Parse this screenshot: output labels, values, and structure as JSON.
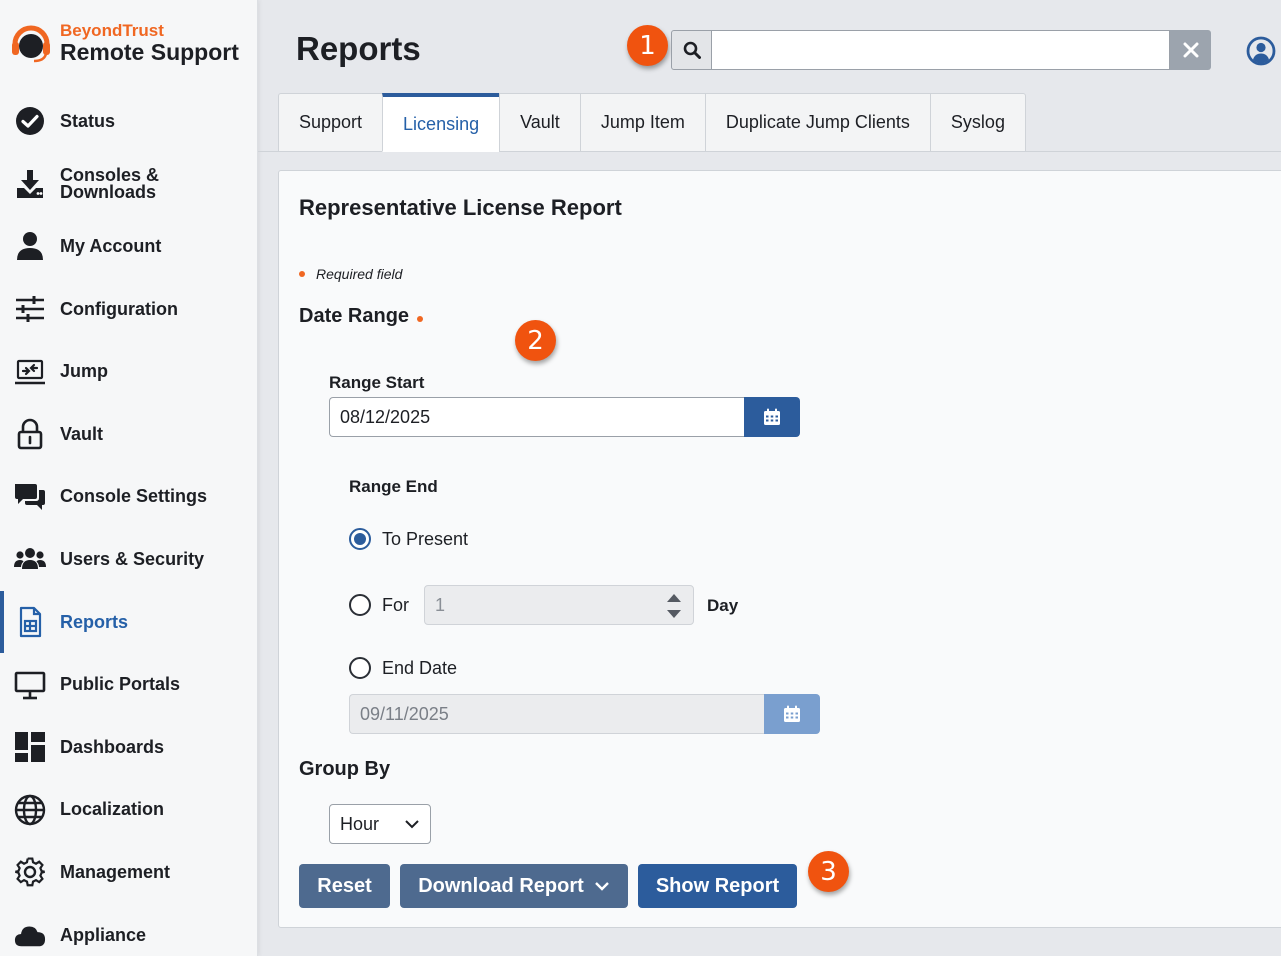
{
  "brand": {
    "top": "BeyondTrust",
    "bottom": "Remote Support"
  },
  "nav": {
    "items": [
      {
        "label": "Status",
        "icon": "check-circle-icon"
      },
      {
        "label": "Consoles & Downloads",
        "icon": "download-icon"
      },
      {
        "label": "My Account",
        "icon": "user-icon"
      },
      {
        "label": "Configuration",
        "icon": "sliders-icon"
      },
      {
        "label": "Jump",
        "icon": "jump-icon"
      },
      {
        "label": "Vault",
        "icon": "lock-icon"
      },
      {
        "label": "Console Settings",
        "icon": "chat-icon"
      },
      {
        "label": "Users & Security",
        "icon": "users-icon"
      },
      {
        "label": "Reports",
        "icon": "report-icon",
        "active": true
      },
      {
        "label": "Public Portals",
        "icon": "monitor-icon"
      },
      {
        "label": "Dashboards",
        "icon": "dashboard-icon"
      },
      {
        "label": "Localization",
        "icon": "globe-icon"
      },
      {
        "label": "Management",
        "icon": "gear-icon"
      },
      {
        "label": "Appliance",
        "icon": "cloud-icon"
      }
    ]
  },
  "header": {
    "title": "Reports",
    "search_value": ""
  },
  "badges": [
    "1",
    "2",
    "3"
  ],
  "tabs": [
    {
      "label": "Support"
    },
    {
      "label": "Licensing",
      "active": true
    },
    {
      "label": "Vault"
    },
    {
      "label": "Jump Item"
    },
    {
      "label": "Duplicate Jump Clients"
    },
    {
      "label": "Syslog"
    }
  ],
  "report": {
    "title": "Representative License Report",
    "required_note": "Required field",
    "date_range_label": "Date Range",
    "range_start_label": "Range Start",
    "range_start_value": "08/12/2025",
    "range_end_label": "Range End",
    "option_to_present": "To Present",
    "option_for": "For",
    "for_value": "1",
    "for_unit": "Day",
    "option_end_date": "End Date",
    "end_date_value": "09/11/2025",
    "selected_option": "To Present",
    "group_by_label": "Group By",
    "group_by_value": "Hour"
  },
  "buttons": {
    "reset": "Reset",
    "download": "Download Report",
    "show": "Show Report"
  },
  "colors": {
    "accent": "#2c5c9c",
    "brand_orange": "#f06722",
    "badge": "#f0530f"
  }
}
